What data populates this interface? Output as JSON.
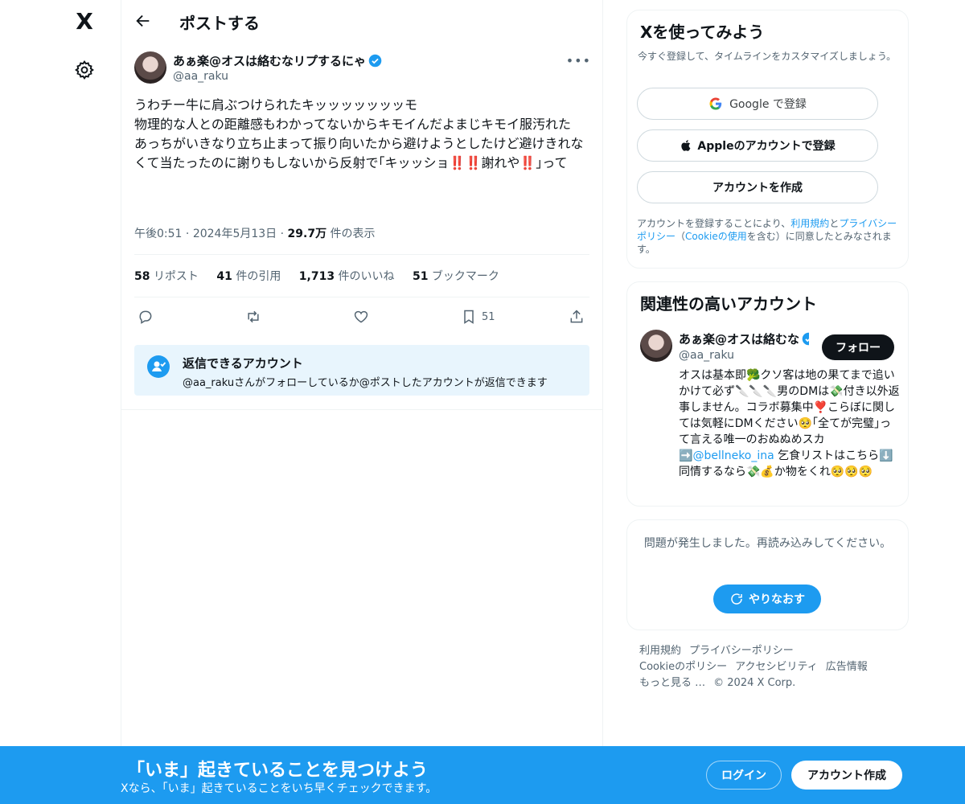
{
  "brand": {
    "logo": "X"
  },
  "header": {
    "title": "ポストする"
  },
  "tweet": {
    "author_name": "あぁ楽@オスは絡むなリプするにゃ",
    "author_handle": "@aa_raku",
    "text": "うわチー牛に肩ぶつけられたキッッッッッッッモ\n物理的な人との距離感もわかってないからキモイんだよまじキモイ服汚れた\nあっちがいきなり立ち止まって振り向いたから避けようとしたけど避けきれなくて当たったのに謝りもしないから反射で｢キッッショ‼️‼️謝れや‼️｣って",
    "time": "午後0:51",
    "date": "2024年5月13日",
    "views_count": "29.7万",
    "views_label": "件の表示",
    "reposts_count": "58",
    "reposts_label": "リポスト",
    "quotes_count": "41",
    "quotes_label": "件の引用",
    "likes_count": "1,713",
    "likes_label": "件のいいね",
    "bookmarks_count": "51",
    "bookmarks_label": "ブックマーク",
    "bookmark_action_count": "51"
  },
  "reply_restriction": {
    "title": "返信できるアカウント",
    "description": "@aa_rakuさんがフォローしているか@ポストしたアカウントが返信できます"
  },
  "signup_card": {
    "title": "Xを使ってみよう",
    "subtitle": "今すぐ登録して、タイムラインをカスタマイズしましょう。",
    "google_label": "Google で登録",
    "apple_label": "Appleのアカウントで登録",
    "create_label": "アカウントを作成",
    "terms_prefix": "アカウントを登録することにより、",
    "terms_link": "利用規約",
    "terms_and": "と",
    "privacy_link": "プライバシーポリシー",
    "cookie_open": "（",
    "cookie_link": "Cookieの使用",
    "cookie_suffix": "を含む）に同意したとみなされます。"
  },
  "related": {
    "title": "関連性の高いアカウント",
    "name": "あぁ楽@オスは絡むな",
    "handle": "@aa_raku",
    "follow_label": "フォロー",
    "bio_part1": "オスは基本即🥦クソ客は地の果てまで追いかけて必ず🔪🔪🔪男のDMは💸付き以外返事しません。コラボ募集中❣️こらぼに関しては気軽にDMください🥺｢全てが完璧｣って言える唯一のおぬぬめスカ➡️",
    "bio_link": "@bellneko_ina",
    "bio_part2": " 乞食リストはこちら⬇️同情するなら💸💰か物をくれ🥺🥺🥺"
  },
  "error_card": {
    "message": "問題が発生しました。再読み込みしてください。",
    "retry_label": "やりなおす"
  },
  "footer": {
    "terms": "利用規約",
    "privacy": "プライバシーポリシー",
    "cookie": "Cookieのポリシー",
    "accessibility": "アクセシビリティ",
    "ads": "広告情報",
    "more": "もっと見る …",
    "copyright": "© 2024 X Corp."
  },
  "bottom_bar": {
    "title": "「いま」起きていることを見つけよう",
    "subtitle": "Xなら、「いま」起きていることをいち早くチェックできます。",
    "login_label": "ログイン",
    "signup_label": "アカウント作成"
  }
}
